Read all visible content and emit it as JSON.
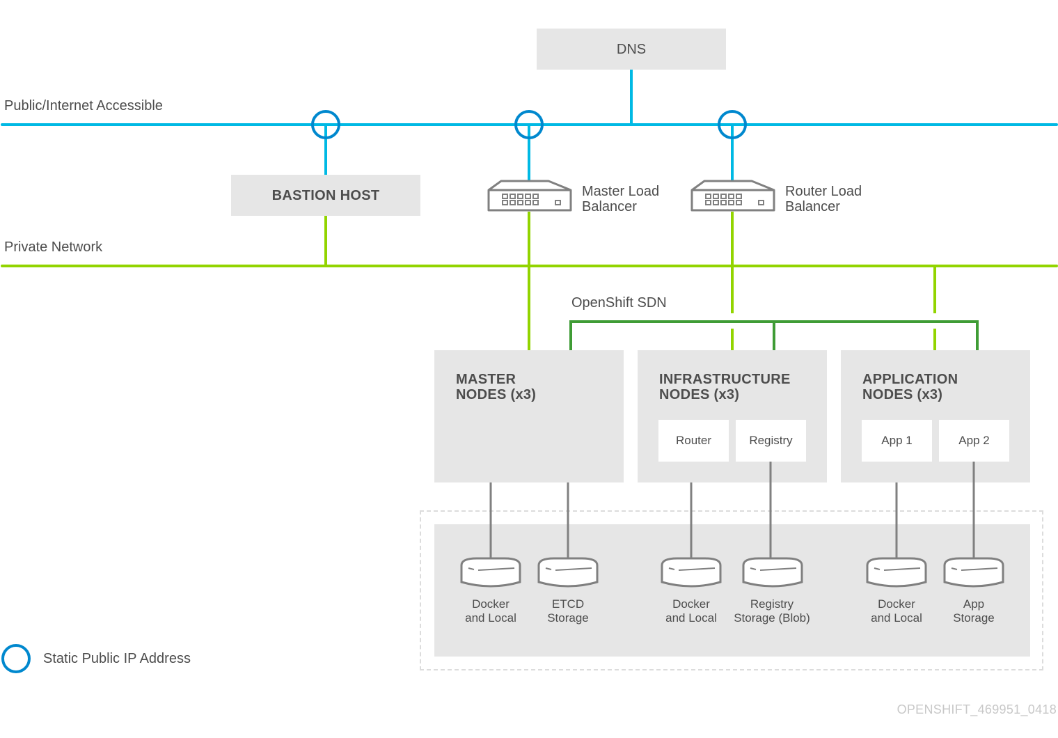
{
  "colors": {
    "public_network": "#00b9e4",
    "private_network": "#92d400",
    "sdn": "#3f9c35",
    "static_ip": "#0088ce",
    "box_fill": "#e6e6e6",
    "storage_line": "#808080",
    "text": "#4d4d4d",
    "watermark": "#c8c8c8"
  },
  "networks": {
    "public_label": "Public/Internet Accessible",
    "private_label": "Private Network",
    "sdn_label": "OpenShift SDN"
  },
  "dns": {
    "label": "DNS"
  },
  "bastion": {
    "label": "BASTION HOST"
  },
  "load_balancers": [
    {
      "line1": "Master Load",
      "line2": "Balancer",
      "icon": "network-switch-icon"
    },
    {
      "line1": "Router Load",
      "line2": "Balancer",
      "icon": "network-switch-icon"
    }
  ],
  "node_groups": [
    {
      "line1": "MASTER",
      "line2": "NODES (x3)",
      "components": []
    },
    {
      "line1": "INFRASTRUCTURE",
      "line2": "NODES (x3)",
      "components": [
        "Router",
        "Registry"
      ]
    },
    {
      "line1": "APPLICATION",
      "line2": "NODES (x3)",
      "components": [
        "App 1",
        "App 2"
      ]
    }
  ],
  "storage": [
    {
      "line1": "Docker",
      "line2": "and Local"
    },
    {
      "line1": "ETCD",
      "line2": "Storage"
    },
    {
      "line1": "Docker",
      "line2": "and Local"
    },
    {
      "line1": "Registry",
      "line2": "Storage (Blob)"
    },
    {
      "line1": "Docker",
      "line2": "and Local"
    },
    {
      "line1": "App",
      "line2": "Storage"
    }
  ],
  "legend": {
    "static_ip_label": "Static Public IP Address",
    "icon": "static-ip-circle-icon"
  },
  "watermark": "OPENSHIFT_469951_0418"
}
